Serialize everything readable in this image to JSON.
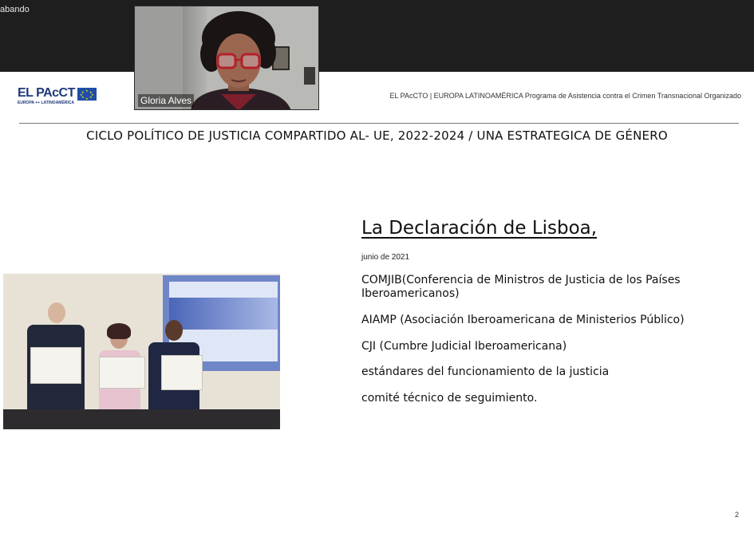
{
  "meeting": {
    "status_text": "abando",
    "participant_name": "Gloria Alves"
  },
  "slide": {
    "logo_text": "EL PAcCT",
    "logo_subtitle": "EUROPA ++ LATINOAMÉRICA",
    "program_header": "EL PAcCTO | EUROPA LATINOAMÉRICA Programa de Asistencia contra el Crimen Transnacional Organizado",
    "title": "CICLO POLÍTICO DE JUSTICIA COMPARTIDO AL- UE, 2022-2024 / UNA ESTRATEGICA DE GÉNERO",
    "heading": "La Declaración de Lisboa,",
    "date": "junio de 2021",
    "bullets": [
      "COMJIB(Conferencia de Ministros de Justicia de los Países Iberoamericanos)",
      "AIAMP (Asociación Iberoamericana de Ministerios Público)",
      "CJI (Cumbre Judicial Iberoamericana)",
      "estándares del funcionamiento de la justicia",
      "comité técnico de seguimiento."
    ],
    "page_number": "2"
  },
  "colors": {
    "top_bar": "#1e1e1e",
    "brand_blue": "#1f3a7a",
    "eu_blue": "#1e4fa8",
    "eu_star": "#f4d81c"
  }
}
